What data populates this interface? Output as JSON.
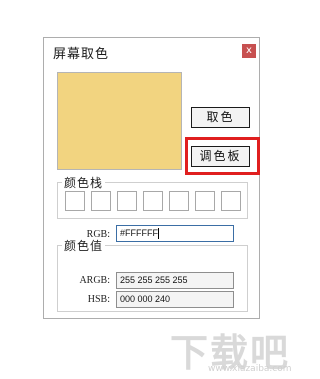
{
  "dialog": {
    "title": "屏幕取色",
    "close_label": "x"
  },
  "preview": {
    "color": "#f2d480"
  },
  "buttons": {
    "pick_label": "取色",
    "palette_label": "调色板"
  },
  "color_stack": {
    "label": "颜色栈",
    "slot_count": 7
  },
  "color_values": {
    "label": "颜色值",
    "rows": [
      {
        "label": "RGB:",
        "value": "#FFFFFF"
      },
      {
        "label": "ARGB:",
        "value": "255 255 255 255"
      },
      {
        "label": "HSB:",
        "value": "000 000 240"
      }
    ]
  },
  "watermark": {
    "text": "下载吧",
    "sub": "www.xiazaiba.com"
  },
  "colors": {
    "highlight": "#e01f1f",
    "close_bg": "#c75050"
  }
}
